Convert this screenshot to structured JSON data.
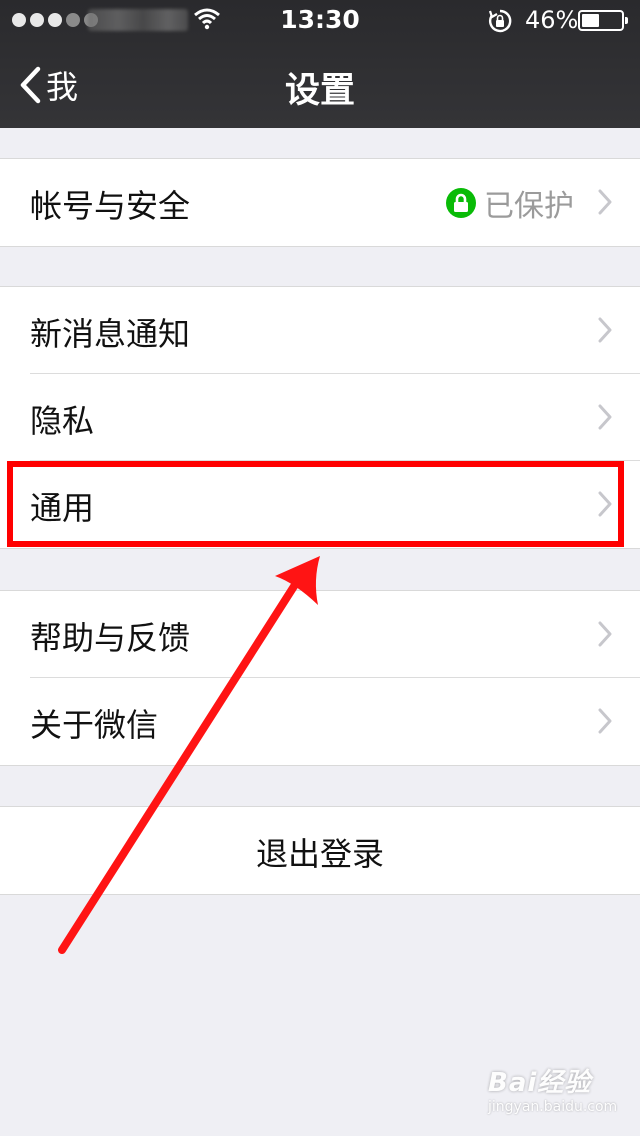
{
  "status_bar": {
    "time": "13:30",
    "battery_percent": "46%",
    "battery_level": 0.46
  },
  "nav": {
    "back_label": "我",
    "title": "设置"
  },
  "sections": {
    "account": {
      "label": "帐号与安全",
      "status": "已保护"
    },
    "notifications": {
      "label": "新消息通知"
    },
    "privacy": {
      "label": "隐私"
    },
    "general": {
      "label": "通用"
    },
    "help": {
      "label": "帮助与反馈"
    },
    "about": {
      "label": "关于微信"
    }
  },
  "logout": {
    "label": "退出登录"
  },
  "watermark": {
    "brand": "Bai经验",
    "url": "jingyan.baidu.com"
  },
  "colors": {
    "nav_background": "#2f2f31",
    "page_background": "#efeff4",
    "protected_green": "#09bb07",
    "annotation_red": "#ff0000"
  },
  "icons": [
    "back-chevron-icon",
    "wifi-icon",
    "rotation-lock-icon",
    "battery-icon",
    "lock-icon",
    "chevron-right-icon"
  ]
}
